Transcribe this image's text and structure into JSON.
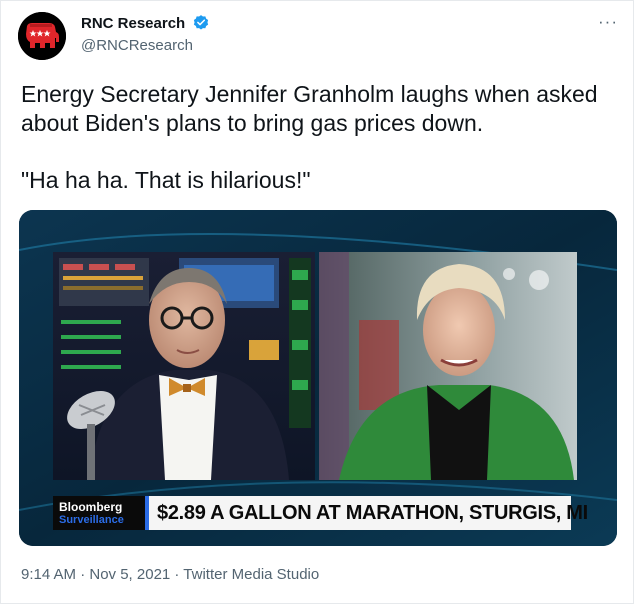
{
  "author": {
    "display_name": "RNC Research",
    "handle": "@RNCResearch",
    "avatar_icon": "gop-elephant-icon",
    "verified_icon": "verified-badge-icon"
  },
  "tweet": {
    "text_line1": "Energy Secretary Jennifer Granholm laughs when asked about Biden's plans to bring gas prices down.",
    "text_line2": "\"Ha ha ha. That is hilarious!\""
  },
  "media": {
    "network_name": "Bloomberg",
    "show_name": "Surveillance",
    "lower_third": "$2.89 A GALLON AT MARATHON, STURGIS, MI"
  },
  "footer": {
    "timestamp": "9:14 AM · Nov 5, 2021 · Twitter Media Studio"
  },
  "colors": {
    "accent": "#1d9bf0",
    "avatar_red": "#e0262b",
    "bloomberg_blue": "#2b6ce6"
  }
}
